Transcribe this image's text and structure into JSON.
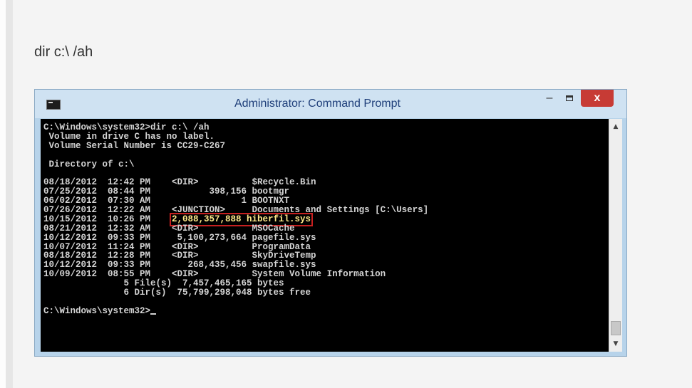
{
  "heading": "dir c:\\ /ah",
  "window": {
    "title": "Administrator: Command Prompt",
    "minimize_glyph": "–",
    "close_glyph": "x",
    "icon": "console-icon"
  },
  "console": {
    "lines": [
      "C:\\Windows\\system32>dir c:\\ /ah",
      " Volume in drive C has no label.",
      " Volume Serial Number is CC29-C267",
      "",
      " Directory of c:\\",
      "",
      "08/18/2012  12:42 PM    <DIR>          $Recycle.Bin",
      "07/25/2012  08:44 PM           398,156 bootmgr",
      "06/02/2012  07:30 AM                 1 BOOTNXT",
      "07/26/2012  12:22 AM    <JUNCTION>     Documents and Settings [C:\\Users]"
    ],
    "highlight": {
      "prefix": "10/15/2012  10:26 PM    ",
      "text": "2,088,357,888 hiberfil.sys"
    },
    "lines_after": [
      "08/21/2012  12:32 AM    <DIR>          MSOCache",
      "10/12/2012  09:33 PM     5,100,273,664 pagefile.sys",
      "10/07/2012  11:24 PM    <DIR>          ProgramData",
      "08/18/2012  12:28 PM    <DIR>          SkyDriveTemp",
      "10/12/2012  09:33 PM       268,435,456 swapfile.sys",
      "10/09/2012  08:55 PM    <DIR>          System Volume Information",
      "               5 File(s)  7,457,465,165 bytes",
      "               6 Dir(s)  75,799,298,048 bytes free",
      ""
    ],
    "prompt": "C:\\Windows\\system32>"
  },
  "scrollbar": {
    "up_glyph": "▲",
    "down_glyph": "▼"
  }
}
